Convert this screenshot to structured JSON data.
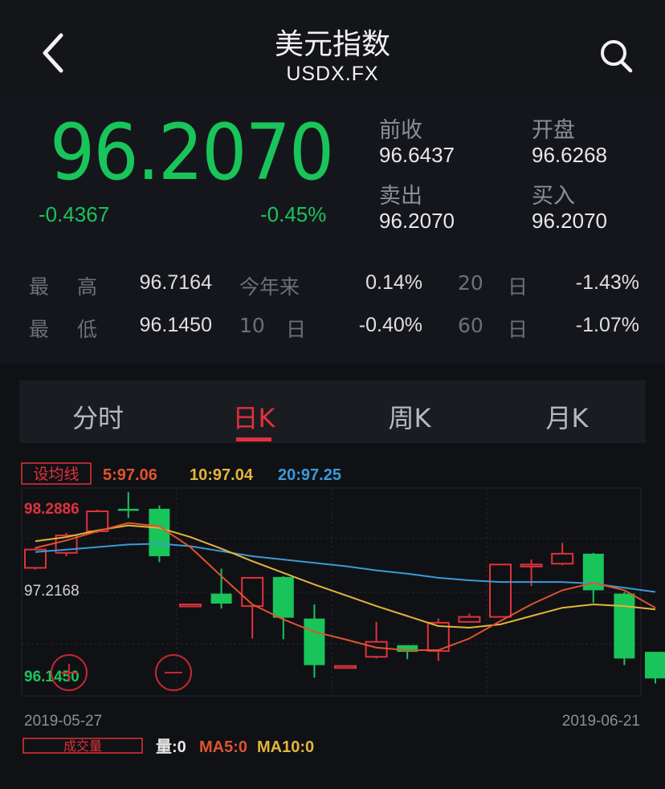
{
  "header": {
    "title": "美元指数",
    "symbol": "USDX.FX",
    "back_icon": "chevron-left-icon",
    "search_icon": "search-icon"
  },
  "quote": {
    "price": "96.2070",
    "change": "-0.4367",
    "change_pct": "-0.45%",
    "prev_close_label": "前收",
    "prev_close": "96.6437",
    "open_label": "开盘",
    "open": "96.6268",
    "sell_label": "卖出",
    "sell": "96.2070",
    "buy_label": "买入",
    "buy": "96.2070"
  },
  "stats": {
    "high_label_1": "最",
    "high_label_2": "高",
    "high": "96.7164",
    "low_label_1": "最",
    "low_label_2": "低",
    "low": "96.1450",
    "ytd_label": "今年来",
    "ytd": "0.14%",
    "d10_label_1": "10",
    "d10_label_2": "日",
    "d10": "-0.40%",
    "d20_label_1": "20",
    "d20_label_2": "日",
    "d20": "-1.43%",
    "d60_label_1": "60",
    "d60_label_2": "日",
    "d60": "-1.07%"
  },
  "tabs": [
    {
      "label": "分时",
      "active": false
    },
    {
      "label": "日K",
      "active": true
    },
    {
      "label": "周K",
      "active": false
    },
    {
      "label": "月K",
      "active": false
    }
  ],
  "ma_bar": {
    "set_ma_button": "设均线",
    "ma5": "5:97.06",
    "ma10": "10:97.04",
    "ma20": "20:97.25"
  },
  "volume_bar": {
    "volume_button": "成交量",
    "vol": "量:0",
    "ma5": "MA5:0",
    "ma10": "MA10:0"
  },
  "colors": {
    "up": "#e0323c",
    "down": "#19c45a",
    "ma5": "#e0532f",
    "ma10": "#e3b53a",
    "ma20": "#3a9ad9"
  },
  "chart_data": {
    "type": "candlestick",
    "y_labels": {
      "high": "98.2886",
      "mid": "97.2168",
      "low": "96.1450"
    },
    "ylim": [
      96.0,
      98.5
    ],
    "date_start": "2019-05-27",
    "date_end": "2019-06-21",
    "candles": [
      {
        "o": 97.54,
        "c": 97.76,
        "h": 97.78,
        "l": 97.52
      },
      {
        "o": 97.72,
        "c": 97.93,
        "h": 97.96,
        "l": 97.68
      },
      {
        "o": 97.98,
        "c": 98.22,
        "h": 98.24,
        "l": 97.96
      },
      {
        "o": 98.25,
        "c": 98.24,
        "h": 98.45,
        "l": 98.14
      },
      {
        "o": 98.25,
        "c": 97.68,
        "h": 98.29,
        "l": 97.61
      },
      {
        "o": 97.1,
        "c": 97.1,
        "h": 97.1,
        "l": 97.1
      },
      {
        "o": 97.23,
        "c": 97.11,
        "h": 97.53,
        "l": 97.05
      },
      {
        "o": 97.08,
        "c": 97.42,
        "h": 97.42,
        "l": 96.69
      },
      {
        "o": 97.43,
        "c": 96.94,
        "h": 97.44,
        "l": 96.68
      },
      {
        "o": 96.93,
        "c": 96.37,
        "h": 97.1,
        "l": 96.22
      },
      {
        "o": 96.36,
        "c": 96.36,
        "h": 96.36,
        "l": 96.36
      },
      {
        "o": 96.47,
        "c": 96.65,
        "h": 96.89,
        "l": 96.45
      },
      {
        "o": 96.61,
        "c": 96.53,
        "h": 96.61,
        "l": 96.44
      },
      {
        "o": 96.54,
        "c": 96.88,
        "h": 96.93,
        "l": 96.42
      },
      {
        "o": 96.89,
        "c": 96.95,
        "h": 96.99,
        "l": 96.89
      },
      {
        "o": 96.95,
        "c": 97.58,
        "h": 97.58,
        "l": 96.95
      },
      {
        "o": 97.57,
        "c": 97.58,
        "h": 97.64,
        "l": 97.32
      },
      {
        "o": 97.59,
        "c": 97.71,
        "h": 97.84,
        "l": 97.57
      },
      {
        "o": 97.71,
        "c": 97.27,
        "h": 97.72,
        "l": 97.12
      },
      {
        "o": 97.23,
        "c": 96.45,
        "h": 97.25,
        "l": 96.37
      },
      {
        "o": 96.53,
        "c": 96.21,
        "h": 96.53,
        "l": 96.15
      }
    ],
    "ma5": [
      97.78,
      97.87,
      97.98,
      98.08,
      98.04,
      97.79,
      97.44,
      97.1,
      96.92,
      96.77,
      96.68,
      96.58,
      96.55,
      96.55,
      96.69,
      96.9,
      97.1,
      97.27,
      97.36,
      97.27,
      97.06
    ],
    "ma10": [
      97.86,
      97.91,
      97.99,
      98.05,
      98.02,
      97.91,
      97.77,
      97.62,
      97.48,
      97.34,
      97.21,
      97.08,
      96.96,
      96.84,
      96.82,
      96.86,
      96.96,
      97.06,
      97.1,
      97.08,
      97.04
    ],
    "ma20": [
      97.73,
      97.76,
      97.79,
      97.82,
      97.83,
      97.8,
      97.74,
      97.68,
      97.64,
      97.6,
      97.56,
      97.51,
      97.47,
      97.42,
      97.39,
      97.37,
      97.37,
      97.37,
      97.35,
      97.3,
      97.25
    ]
  }
}
